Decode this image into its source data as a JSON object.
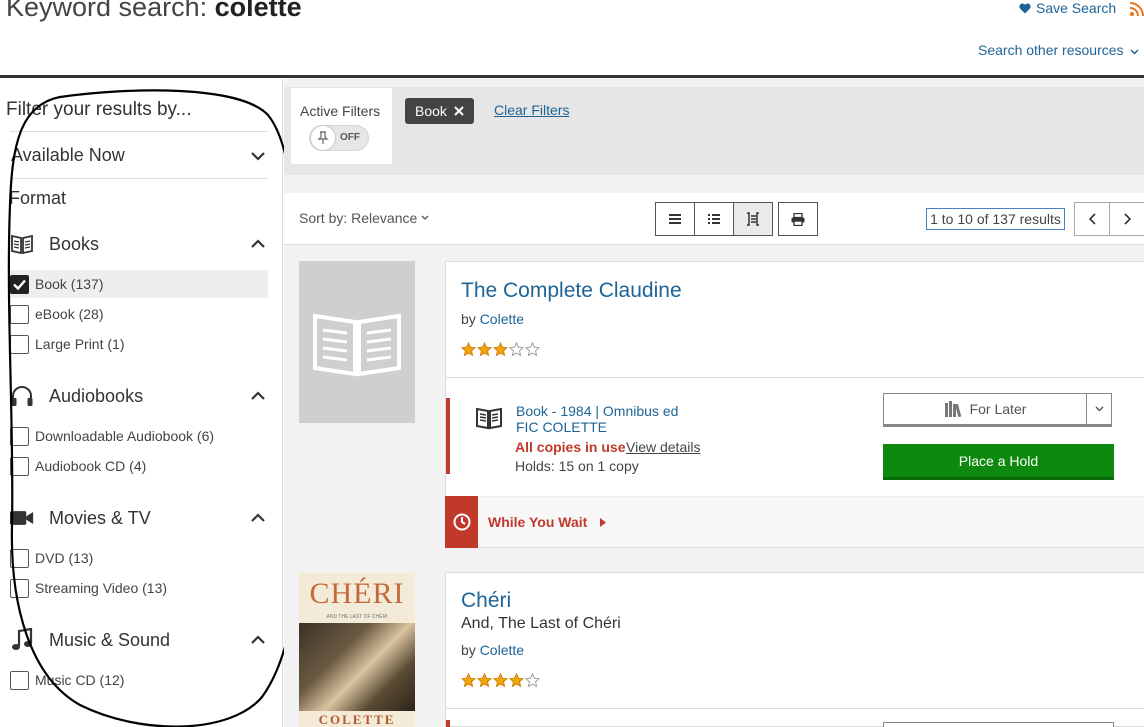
{
  "header": {
    "title_prefix": "Keyword search: ",
    "query": "colette",
    "save_search": "Save Search",
    "search_other": "Search other resources"
  },
  "sidebar": {
    "title": "Filter your results by...",
    "available_now": "Available Now",
    "format": "Format",
    "groups": [
      {
        "label": "Books",
        "icon": "book-icon",
        "options": [
          {
            "label": "Book (137)",
            "checked": true
          },
          {
            "label": "eBook (28)",
            "checked": false
          },
          {
            "label": "Large Print (1)",
            "checked": false
          }
        ]
      },
      {
        "label": "Audiobooks",
        "icon": "headphones-icon",
        "options": [
          {
            "label": "Downloadable Audiobook (6)",
            "checked": false
          },
          {
            "label": "Audiobook CD (4)",
            "checked": false
          }
        ]
      },
      {
        "label": "Movies & TV",
        "icon": "video-camera-icon",
        "options": [
          {
            "label": "DVD (13)",
            "checked": false
          },
          {
            "label": "Streaming Video (13)",
            "checked": false
          }
        ]
      },
      {
        "label": "Music & Sound",
        "icon": "music-note-icon",
        "options": [
          {
            "label": "Music CD (12)",
            "checked": false
          }
        ]
      }
    ]
  },
  "filters": {
    "active_label": "Active Filters",
    "toggle_state": "OFF",
    "chip_label": "Book",
    "clear_label": "Clear Filters"
  },
  "toolbar": {
    "sort_label": "Sort by: Relevance",
    "results_count": "1 to 10 of 137 results"
  },
  "results": [
    {
      "title": "The Complete Claudine",
      "by_prefix": "by ",
      "author": "Colette",
      "rating_stars": 3,
      "format_line": "Book - 1984 | Omnibus ed",
      "call_number": "FIC COLETTE",
      "availability": "All copies in use",
      "view_details": "View details",
      "holds": "Holds: 15 on 1 copy",
      "for_later": "For Later",
      "place_hold": "Place a Hold",
      "while_you_wait": "While You Wait"
    },
    {
      "title": "Chéri",
      "subtitle": "And, The Last of Chéri",
      "by_prefix": "by ",
      "author": "Colette",
      "rating_stars": 4,
      "cover_title": "CHÉRI",
      "cover_subtitle": "AND THE LAST OF CHÉRI",
      "cover_author": "COLETTE"
    }
  ],
  "colors": {
    "link": "#1e6496",
    "hold_button": "#0d8a0d",
    "alert": "#c0392b",
    "star": "#f0a30a"
  }
}
